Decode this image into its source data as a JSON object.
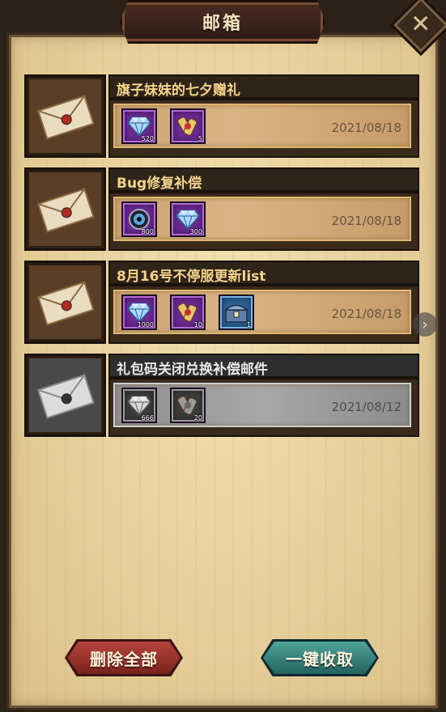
{
  "header": {
    "title": "邮箱",
    "close_icon": "close-x-icon"
  },
  "mails": [
    {
      "title": "旗子妹妹的七夕赠礼",
      "date": "2021/08/18",
      "read": false,
      "items": [
        {
          "icon": "diamond-icon",
          "count": "520",
          "rarity": "purple"
        },
        {
          "icon": "scroll-bundle-icon",
          "count": "5",
          "rarity": "purple"
        }
      ]
    },
    {
      "title": "Bug修复补偿",
      "date": "2021/08/18",
      "read": false,
      "items": [
        {
          "icon": "eye-orb-icon",
          "count": "800",
          "rarity": "purple"
        },
        {
          "icon": "diamond-icon",
          "count": "300",
          "rarity": "purple"
        }
      ]
    },
    {
      "title": "8月16号不停服更新list",
      "date": "2021/08/18",
      "read": false,
      "items": [
        {
          "icon": "diamond-icon",
          "count": "1000",
          "rarity": "purple"
        },
        {
          "icon": "scroll-bundle-icon",
          "count": "10",
          "rarity": "purple"
        },
        {
          "icon": "treasure-chest-icon",
          "count": "1",
          "rarity": "blue"
        }
      ]
    },
    {
      "title": "礼包码关闭兑换补偿邮件",
      "date": "2021/08/12",
      "read": true,
      "items": [
        {
          "icon": "diamond-icon",
          "count": "666",
          "rarity": "gray"
        },
        {
          "icon": "scroll-bundle-icon",
          "count": "20",
          "rarity": "gray"
        }
      ]
    }
  ],
  "buttons": {
    "delete_all": "删除全部",
    "collect_all": "一键收取"
  },
  "colors": {
    "delete": "#9a302a",
    "collect": "#3a857f",
    "title_text": "#f4d38a"
  }
}
